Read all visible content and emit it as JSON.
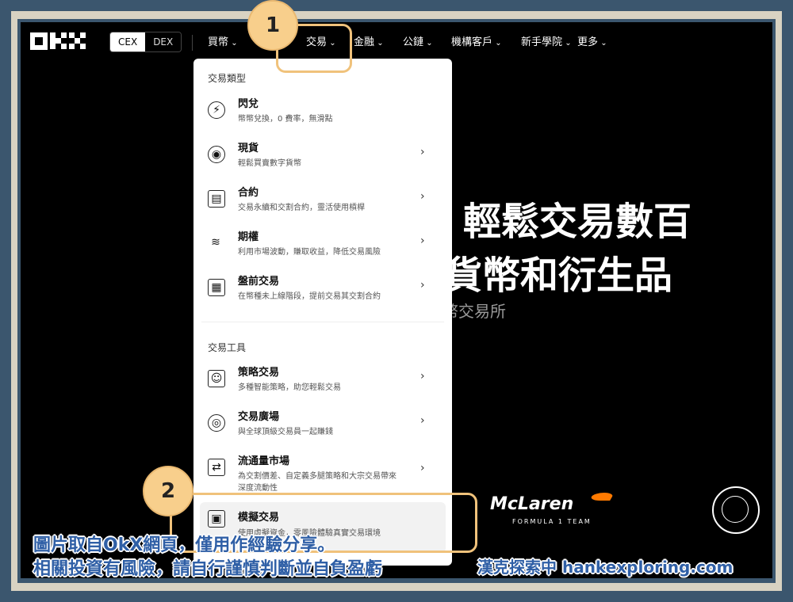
{
  "top_nav": {
    "logo_text": "OKX",
    "switch": {
      "cex": "CEX",
      "dex": "DEX"
    },
    "items": [
      "買幣",
      "交易",
      "金融",
      "公鏈",
      "機構客戶",
      "新手學院",
      "更多"
    ]
  },
  "hero": {
    "line1": "，輕鬆交易數百",
    "line2": "貨幣和衍生品",
    "sub": "幣交易所"
  },
  "dropdown": {
    "section1": "交易類型",
    "types": [
      {
        "title": "閃兌",
        "desc": "幣幣兌換，0 費率，無滑點",
        "icon": "flash-icon",
        "chevron": false
      },
      {
        "title": "現貨",
        "desc": "輕鬆買賣數字貨幣",
        "icon": "spot-icon",
        "chevron": true
      },
      {
        "title": "合約",
        "desc": "交易永續和交割合約，靈活使用槓桿",
        "icon": "contract-icon",
        "chevron": true
      },
      {
        "title": "期權",
        "desc": "利用市場波動，賺取收益，降低交易風險",
        "icon": "layers-icon",
        "chevron": true
      },
      {
        "title": "盤前交易",
        "desc": "在幣種未上線階段，提前交易其交割合約",
        "icon": "calendar-icon",
        "chevron": true
      }
    ],
    "section2": "交易工具",
    "tools": [
      {
        "title": "策略交易",
        "desc": "多種智能策略，助您輕鬆交易",
        "icon": "bot-icon",
        "chevron": true
      },
      {
        "title": "交易廣場",
        "desc": "與全球頂級交易員一起賺錢",
        "icon": "circles-icon",
        "chevron": true
      },
      {
        "title": "流通量市場",
        "desc": "為交割價差、自定義多腿策略和大宗交易帶來",
        "desc2": "深度流動性",
        "icon": "swap-icon",
        "chevron": true
      },
      {
        "title": "模擬交易",
        "desc": "使用虛擬資金，零風險體驗真實交易環境",
        "icon": "demo-icon",
        "chevron": false
      }
    ]
  },
  "sponsors": {
    "mclaren": "McLaren",
    "mclaren_sub": "FORMULA 1 TEAM"
  },
  "annotations": {
    "badge1": "1",
    "badge2": "2"
  },
  "caption": {
    "line1": "圖片取自OkX網頁，僅用作經驗分享。",
    "line2": "相關投資有風險，請自行謹慎判斷並自負盈虧",
    "credit": "漢克探索中 hankexploring.com"
  },
  "colors": {
    "frame": "#d8d2c2",
    "background": "#3b566e",
    "badge": "#f8cf8c",
    "caption": "#2f5fa6"
  }
}
